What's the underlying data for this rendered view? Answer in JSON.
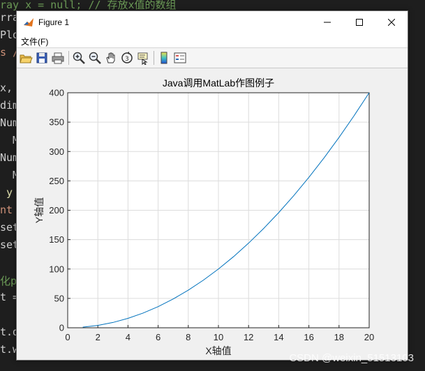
{
  "background_code": [
    {
      "text": "ray x = null; // 存放x值的数组",
      "cls": "green",
      "top": -4
    },
    {
      "text": "rra",
      "cls": "",
      "top": 16
    },
    {
      "text": "Plo",
      "cls": "",
      "top": 41
    },
    {
      "text": "s /",
      "cls": "orange",
      "top": 66
    },
    {
      "text": "x,",
      "cls": "",
      "top": 117
    },
    {
      "text": "dim",
      "cls": "",
      "top": 142
    },
    {
      "text": "Num",
      "cls": "",
      "top": 167
    },
    {
      "text": "  M",
      "cls": "",
      "top": 192
    },
    {
      "text": "Num",
      "cls": "",
      "top": 217
    },
    {
      "text": "  M",
      "cls": "",
      "top": 242
    },
    {
      "text": " y",
      "cls": "yellow",
      "top": 267
    },
    {
      "text": "nt",
      "cls": "orange",
      "top": 292
    },
    {
      "text": "set",
      "cls": "",
      "top": 317
    },
    {
      "text": "set",
      "cls": "",
      "top": 342
    },
    {
      "text": "化p",
      "cls": "green",
      "top": 392
    },
    {
      "text": "t =",
      "cls": "",
      "top": 417
    },
    {
      "text": "t.d",
      "cls": "",
      "top": 467
    },
    {
      "text": "t.w",
      "cls": "",
      "top": 492
    }
  ],
  "window": {
    "title": "Figure 1",
    "menu_file": "文件(F)"
  },
  "colors": {
    "line": "#0072bd",
    "grid": "#dcdcdc",
    "axes": "#262626"
  },
  "toolbar_icons": [
    "open-icon",
    "save-icon",
    "print-icon",
    "sep",
    "zoom-in-icon",
    "zoom-out-icon",
    "pan-icon",
    "rotate-icon",
    "data-cursor-icon",
    "sep",
    "colorbar-icon",
    "legend-icon"
  ],
  "watermark": "CSDN @weixin_51513103",
  "chart_data": {
    "type": "line",
    "title": "Java调用MatLab作图例子",
    "xlabel": "X轴值",
    "ylabel": "Y轴值",
    "xlim": [
      0,
      20
    ],
    "ylim": [
      0,
      400
    ],
    "xticks": [
      0,
      2,
      4,
      6,
      8,
      10,
      12,
      14,
      16,
      18,
      20
    ],
    "yticks": [
      0,
      50,
      100,
      150,
      200,
      250,
      300,
      350,
      400
    ],
    "grid": true,
    "x": [
      1,
      2,
      3,
      4,
      5,
      6,
      7,
      8,
      9,
      10,
      11,
      12,
      13,
      14,
      15,
      16,
      17,
      18,
      19,
      20
    ],
    "y": [
      1,
      4,
      9,
      16,
      25,
      36,
      49,
      64,
      81,
      100,
      121,
      144,
      169,
      196,
      225,
      256,
      289,
      324,
      361,
      400
    ]
  }
}
